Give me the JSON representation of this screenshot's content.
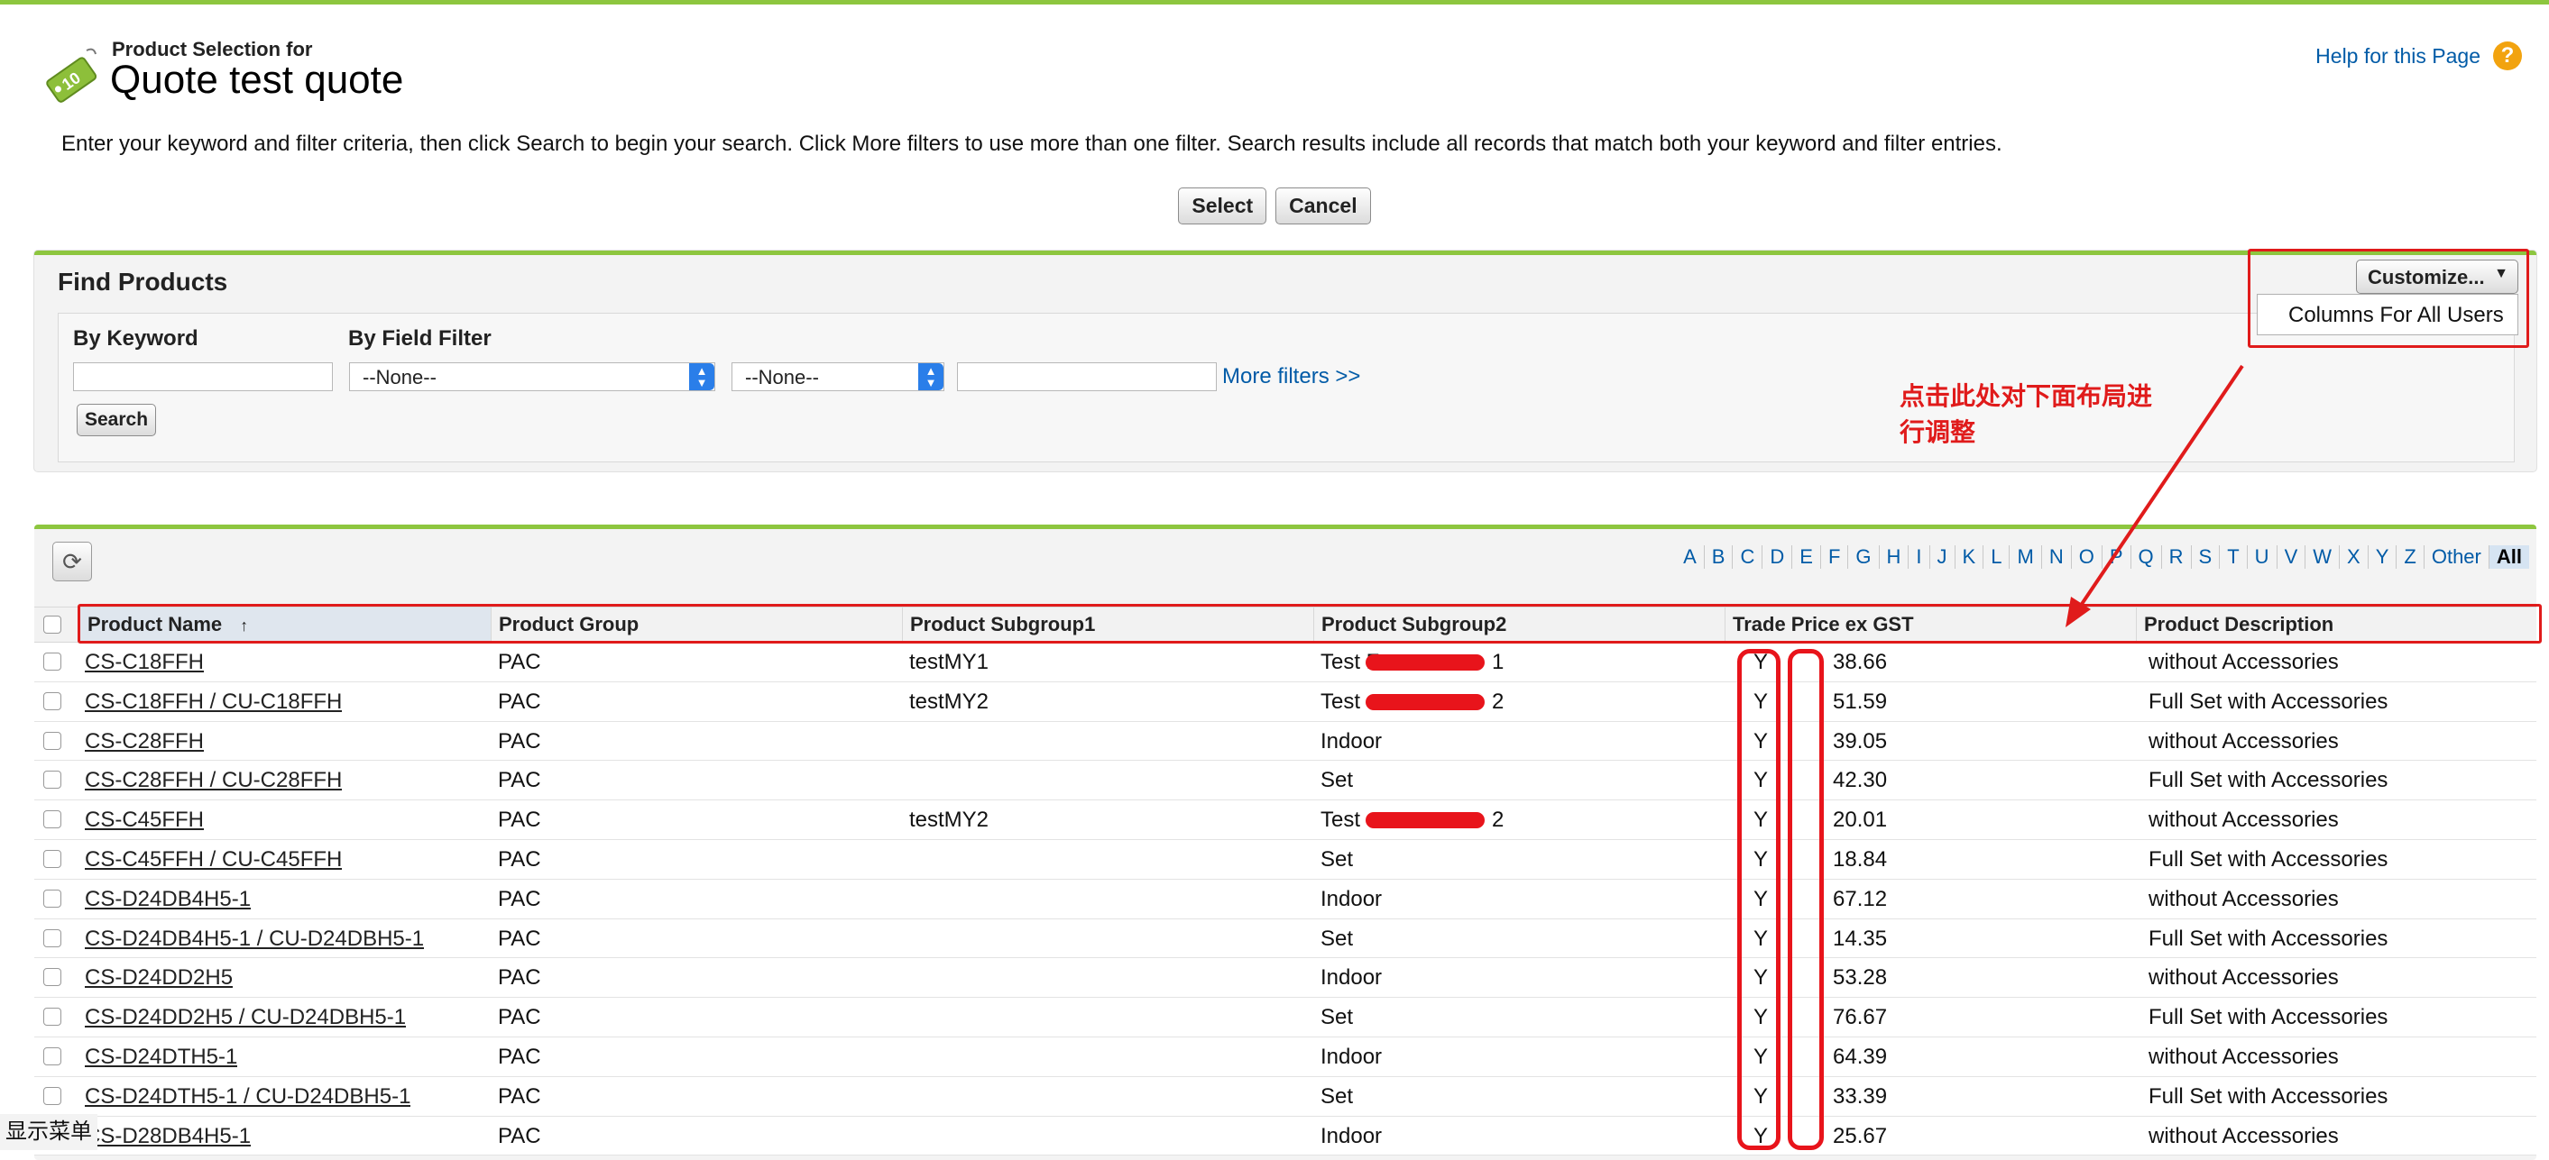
{
  "header": {
    "subtitle": "Product Selection for",
    "title": "Quote test quote",
    "help_link": "Help for this Page",
    "help_badge": "?",
    "tag_icon_text": "10"
  },
  "intro": "Enter your keyword and filter criteria, then click Search to begin your search. Click More filters to use more than one filter. Search results include all records that match both your keyword and filter entries.",
  "actions": {
    "select": "Select",
    "cancel": "Cancel"
  },
  "find_panel": {
    "title": "Find Products",
    "keyword_label": "By Keyword",
    "keyword_value": "",
    "filter_label": "By Field Filter",
    "field_select": "--None--",
    "operator_select": "--None--",
    "filter_value": "",
    "more_filters": "More filters >>",
    "search_button": "Search"
  },
  "customize": {
    "button": "Customize...",
    "menu_item": "Columns For All Users",
    "annotation_line1": "点击此处对下面布局进",
    "annotation_line2": "行调整"
  },
  "alpha_filter": [
    "A",
    "B",
    "C",
    "D",
    "E",
    "F",
    "G",
    "H",
    "I",
    "J",
    "K",
    "L",
    "M",
    "N",
    "O",
    "P",
    "Q",
    "R",
    "S",
    "T",
    "U",
    "V",
    "W",
    "X",
    "Y",
    "Z",
    "Other"
  ],
  "alpha_selected": "All",
  "table": {
    "columns": [
      "Product Name",
      "Product Group",
      "Product Subgroup1",
      "Product Subgroup2",
      "Trade Price ex GST",
      "Product Description"
    ],
    "sort_indicator": "↑",
    "rows": [
      {
        "name": "CS-C18FFH",
        "group": "PAC",
        "sub1": "testMY1",
        "sub2": "Test F",
        "sub2_tail": "1",
        "price": "38.66",
        "desc": "without Accessories"
      },
      {
        "name": "CS-C18FFH / CU-C18FFH",
        "group": "PAC",
        "sub1": "testMY2",
        "sub2": "Test",
        "sub2_tail": "2",
        "price": "51.59",
        "desc": "Full Set with Accessories"
      },
      {
        "name": "CS-C28FFH",
        "group": "PAC",
        "sub1": "",
        "sub2": "Indoor",
        "sub2_tail": "",
        "price": "39.05",
        "desc": "without Accessories"
      },
      {
        "name": "CS-C28FFH / CU-C28FFH",
        "group": "PAC",
        "sub1": "",
        "sub2": "Set",
        "sub2_tail": "",
        "price": "42.30",
        "desc": "Full Set with Accessories"
      },
      {
        "name": "CS-C45FFH",
        "group": "PAC",
        "sub1": "testMY2",
        "sub2": "Test",
        "sub2_tail": "2",
        "price": "20.01",
        "desc": "without Accessories"
      },
      {
        "name": "CS-C45FFH / CU-C45FFH",
        "group": "PAC",
        "sub1": "",
        "sub2": "Set",
        "sub2_tail": "",
        "price": "18.84",
        "desc": "Full Set with Accessories"
      },
      {
        "name": "CS-D24DB4H5-1",
        "group": "PAC",
        "sub1": "",
        "sub2": "Indoor",
        "sub2_tail": "",
        "price": "67.12",
        "desc": "without Accessories"
      },
      {
        "name": "CS-D24DB4H5-1 / CU-D24DBH5-1",
        "group": "PAC",
        "sub1": "",
        "sub2": "Set",
        "sub2_tail": "",
        "price": "14.35",
        "desc": "Full Set with Accessories"
      },
      {
        "name": "CS-D24DD2H5",
        "group": "PAC",
        "sub1": "",
        "sub2": "Indoor",
        "sub2_tail": "",
        "price": "53.28",
        "desc": "without Accessories"
      },
      {
        "name": "CS-D24DD2H5 / CU-D24DBH5-1",
        "group": "PAC",
        "sub1": "",
        "sub2": "Set",
        "sub2_tail": "",
        "price": "76.67",
        "desc": "Full Set with Accessories"
      },
      {
        "name": "CS-D24DTH5-1",
        "group": "PAC",
        "sub1": "",
        "sub2": "Indoor",
        "sub2_tail": "",
        "price": "64.39",
        "desc": "without Accessories"
      },
      {
        "name": "CS-D24DTH5-1 / CU-D24DBH5-1",
        "group": "PAC",
        "sub1": "",
        "sub2": "Set",
        "sub2_tail": "",
        "price": "33.39",
        "desc": "Full Set with Accessories"
      },
      {
        "name": "CS-D28DB4H5-1",
        "group": "PAC",
        "sub1": "",
        "sub2": "Indoor",
        "sub2_tail": "",
        "price": "25.67",
        "desc": "without Accessories"
      }
    ],
    "price_prefix_visible": "Y"
  },
  "bottom_overlay": "显示菜单",
  "colors": {
    "accent_green": "#8dc63f",
    "link_blue": "#015ba7",
    "annotation_red": "#e01b1b"
  }
}
